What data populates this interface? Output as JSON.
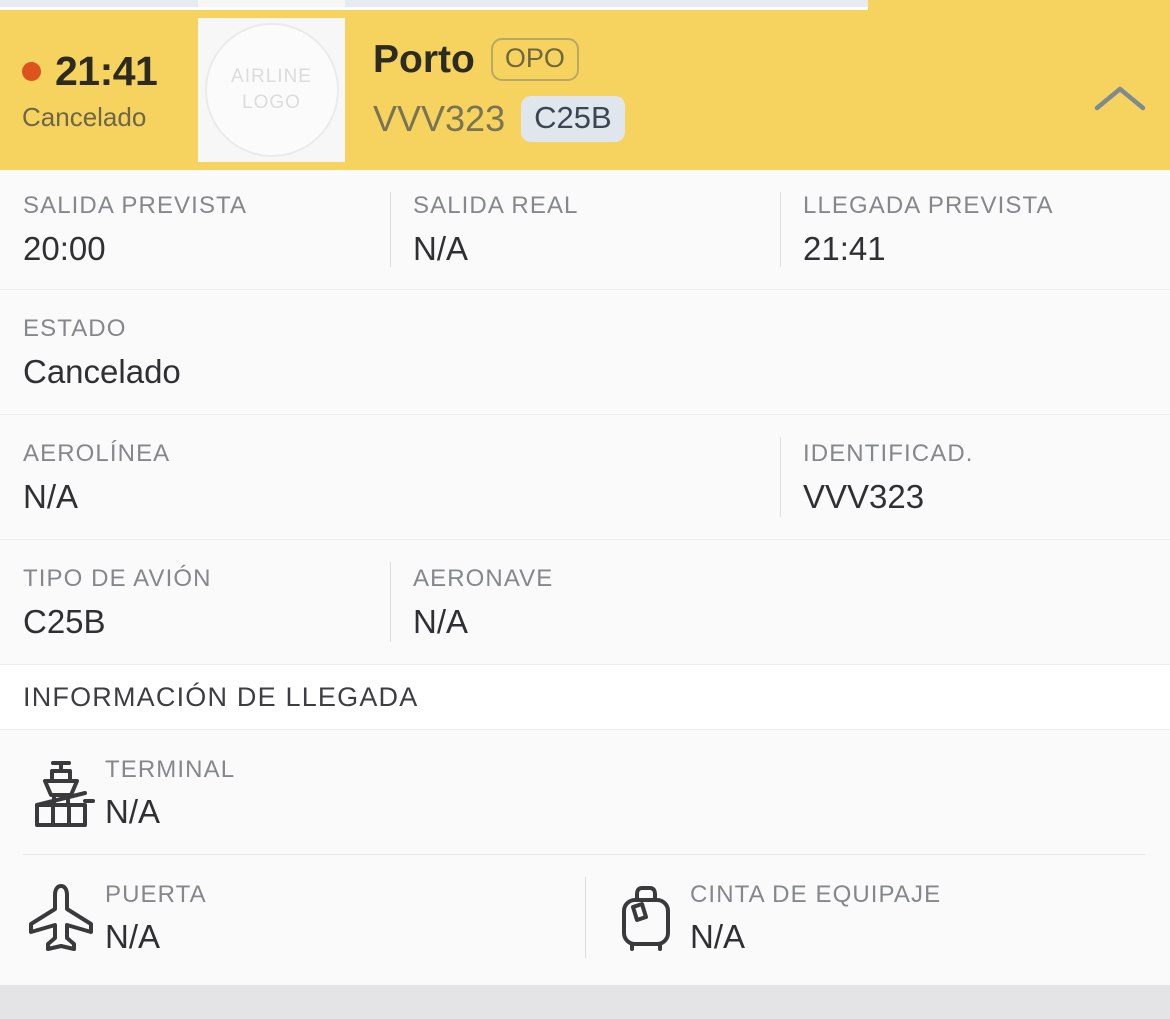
{
  "header": {
    "arrival_time": "21:41",
    "status_short": "Cancelado",
    "status_dot_color": "#de521e",
    "logo_placeholder_line1": "AIRLINE",
    "logo_placeholder_line2": "LOGO",
    "city": "Porto",
    "iata": "OPO",
    "flight_number": "VVV323",
    "aircraft_code": "C25B",
    "collapse_icon": "chevron-up-icon",
    "background_color": "#f6d35f"
  },
  "times_row": [
    {
      "label": "SALIDA PREVISTA",
      "value": "20:00"
    },
    {
      "label": "SALIDA REAL",
      "value": "N/A"
    },
    {
      "label": "LLEGADA PREVISTA",
      "value": "21:41"
    }
  ],
  "status_row": {
    "label": "ESTADO",
    "value": "Cancelado"
  },
  "airline_row": [
    {
      "label": "AEROLÍNEA",
      "value": "N/A"
    },
    {
      "label": "IDENTIFICAD.",
      "value": "VVV323"
    }
  ],
  "aircraft_row": [
    {
      "label": "TIPO DE AVIÓN",
      "value": "C25B"
    },
    {
      "label": "AERONAVE",
      "value": "N/A"
    }
  ],
  "arrival_section": {
    "title": "INFORMACIÓN DE LLEGADA",
    "terminal": {
      "icon": "control-tower-icon",
      "label": "TERMINAL",
      "value": "N/A"
    },
    "gate": {
      "icon": "airplane-icon",
      "label": "PUERTA",
      "value": "N/A"
    },
    "baggage": {
      "icon": "suitcase-icon",
      "label": "CINTA DE EQUIPAJE",
      "value": "N/A"
    }
  }
}
